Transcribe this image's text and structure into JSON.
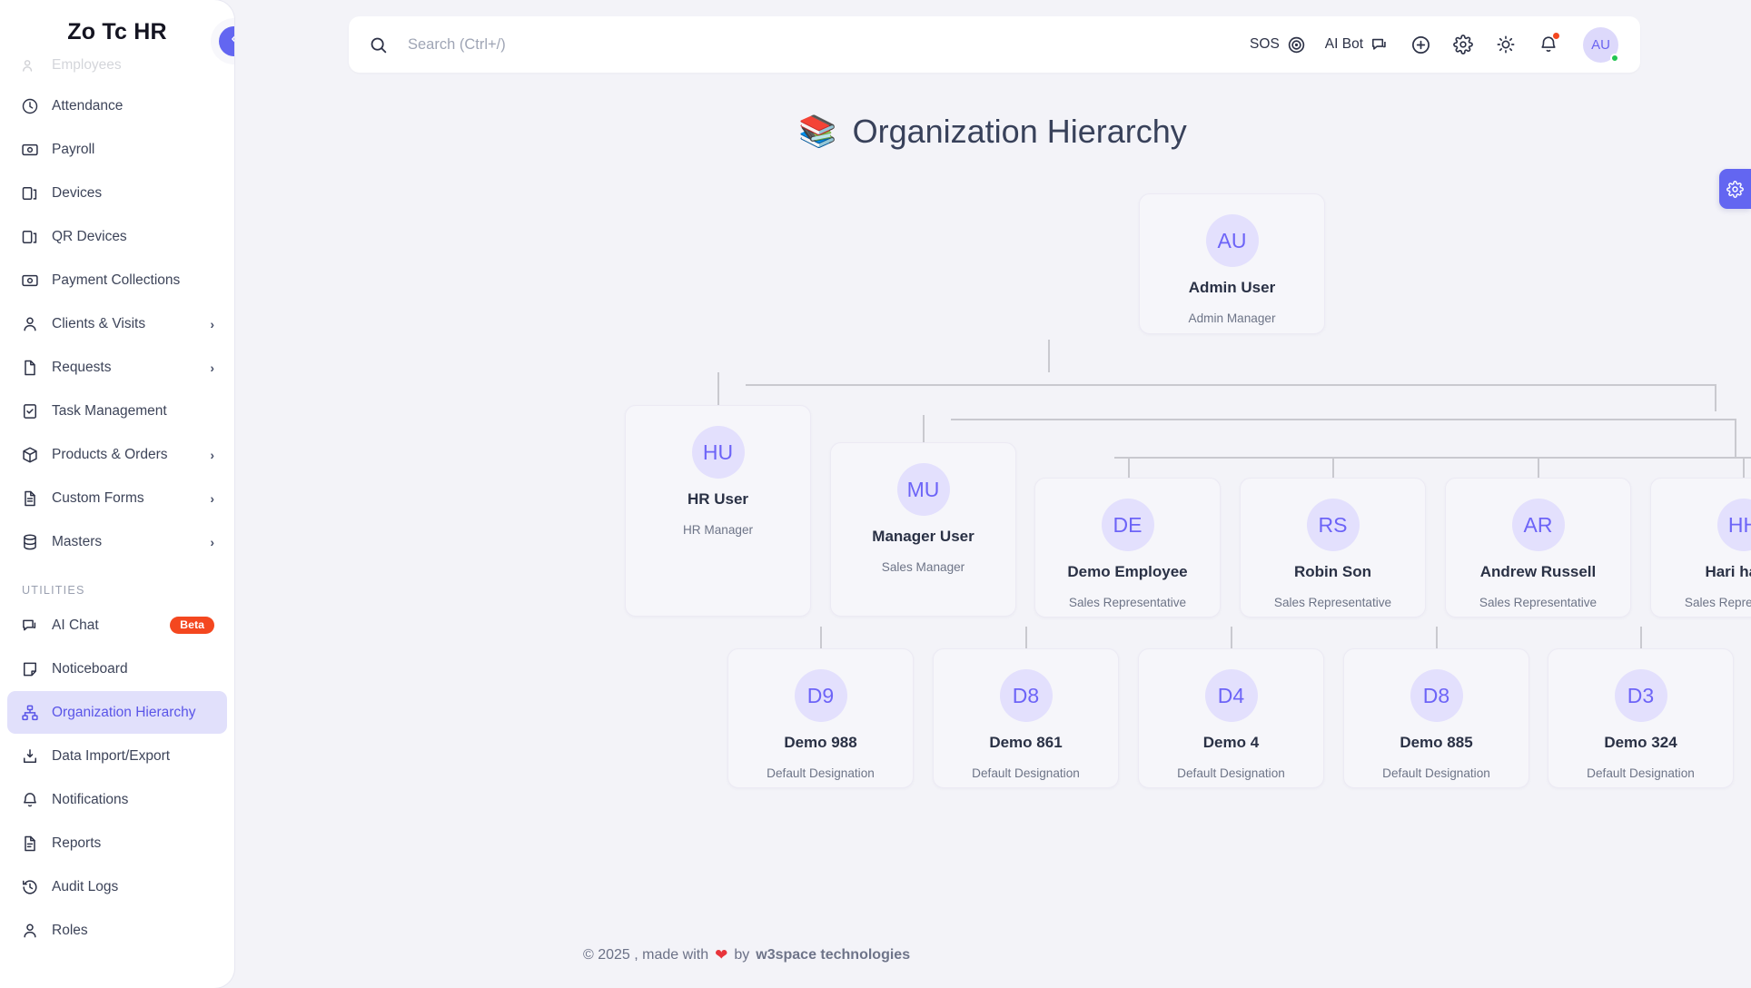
{
  "brand": {
    "name": "Zo Tc HR"
  },
  "sidebar": {
    "items": [
      {
        "label": "Employees",
        "icon": "users-icon",
        "state": "faded"
      },
      {
        "label": "Attendance",
        "icon": "clock-icon"
      },
      {
        "label": "Payroll",
        "icon": "money-icon"
      },
      {
        "label": "Devices",
        "icon": "device-icon"
      },
      {
        "label": "QR Devices",
        "icon": "device-icon"
      },
      {
        "label": "Payment Collections",
        "icon": "money-icon"
      },
      {
        "label": "Clients & Visits",
        "icon": "user-icon",
        "chevron": "›"
      },
      {
        "label": "Requests",
        "icon": "file-icon",
        "chevron": "›"
      },
      {
        "label": "Task Management",
        "icon": "clipboard-check-icon"
      },
      {
        "label": "Products & Orders",
        "icon": "box-icon",
        "chevron": "›"
      },
      {
        "label": "Custom Forms",
        "icon": "file-lines-icon",
        "chevron": "›"
      },
      {
        "label": "Masters",
        "icon": "database-icon",
        "chevron": "›"
      }
    ],
    "section_label": "UTILITIES",
    "utilities": [
      {
        "label": "AI Chat",
        "icon": "chat-icon",
        "badge": "Beta"
      },
      {
        "label": "Noticeboard",
        "icon": "note-icon"
      },
      {
        "label": "Organization Hierarchy",
        "icon": "hierarchy-icon",
        "state": "active"
      },
      {
        "label": "Data Import/Export",
        "icon": "import-export-icon"
      },
      {
        "label": "Notifications",
        "icon": "bell-icon"
      },
      {
        "label": "Reports",
        "icon": "report-icon"
      },
      {
        "label": "Audit Logs",
        "icon": "history-icon"
      },
      {
        "label": "Roles",
        "icon": "user-icon"
      }
    ],
    "collapse_icon": "chevron-left-icon"
  },
  "topbar": {
    "search": {
      "value": "",
      "placeholder": "Search (Ctrl+/)",
      "icon": "search-icon"
    },
    "sos_label": "SOS",
    "sos_icon": "target-icon",
    "aibot_label": "AI Bot",
    "aibot_icon": "chat-bubble-icon",
    "add_icon": "plus-circle-icon",
    "settings_icon": "gear-icon",
    "theme_icon": "sun-icon",
    "notifications_icon": "bell-icon",
    "avatar_initials": "AU",
    "avatar_status": "online"
  },
  "float_settings_icon": "gear-icon",
  "page": {
    "title": "Organization Hierarchy",
    "title_emoji": "📚"
  },
  "org": {
    "root": {
      "initials": "AU",
      "name": "Admin User",
      "designation": "Admin Manager"
    },
    "level2": [
      {
        "initials": "HU",
        "name": "HR User",
        "designation": "HR Manager"
      },
      {
        "initials": "MU",
        "name": "Manager User",
        "designation": "Sales Manager"
      }
    ],
    "level3": [
      {
        "initials": "DE",
        "name": "Demo Employee",
        "designation": "Sales Representative"
      },
      {
        "initials": "RS",
        "name": "Robin Son",
        "designation": "Sales Representative"
      },
      {
        "initials": "AR",
        "name": "Andrew Russell",
        "designation": "Sales Representative"
      },
      {
        "initials": "HH",
        "name": "Hari haran",
        "designation": "Sales Representative"
      }
    ],
    "level4": [
      {
        "initials": "D9",
        "name": "Demo 988",
        "designation": "Default Designation"
      },
      {
        "initials": "D8",
        "name": "Demo 861",
        "designation": "Default Designation"
      },
      {
        "initials": "D4",
        "name": "Demo 4",
        "designation": "Default Designation"
      },
      {
        "initials": "D8",
        "name": "Demo 885",
        "designation": "Default Designation"
      },
      {
        "initials": "D3",
        "name": "Demo 324",
        "designation": "Default Designation"
      }
    ]
  },
  "footer": {
    "copyright": "© 2025 , made with",
    "heart": "❤",
    "by": "by",
    "company": "w3space technologies"
  },
  "colors": {
    "accent": "#6366f1",
    "avatar_bg": "#e3e0fd",
    "avatar_text": "#6d64f7",
    "page_bg": "#f3f3f8",
    "badge_beta": "#f4471f",
    "online": "#23c552"
  }
}
